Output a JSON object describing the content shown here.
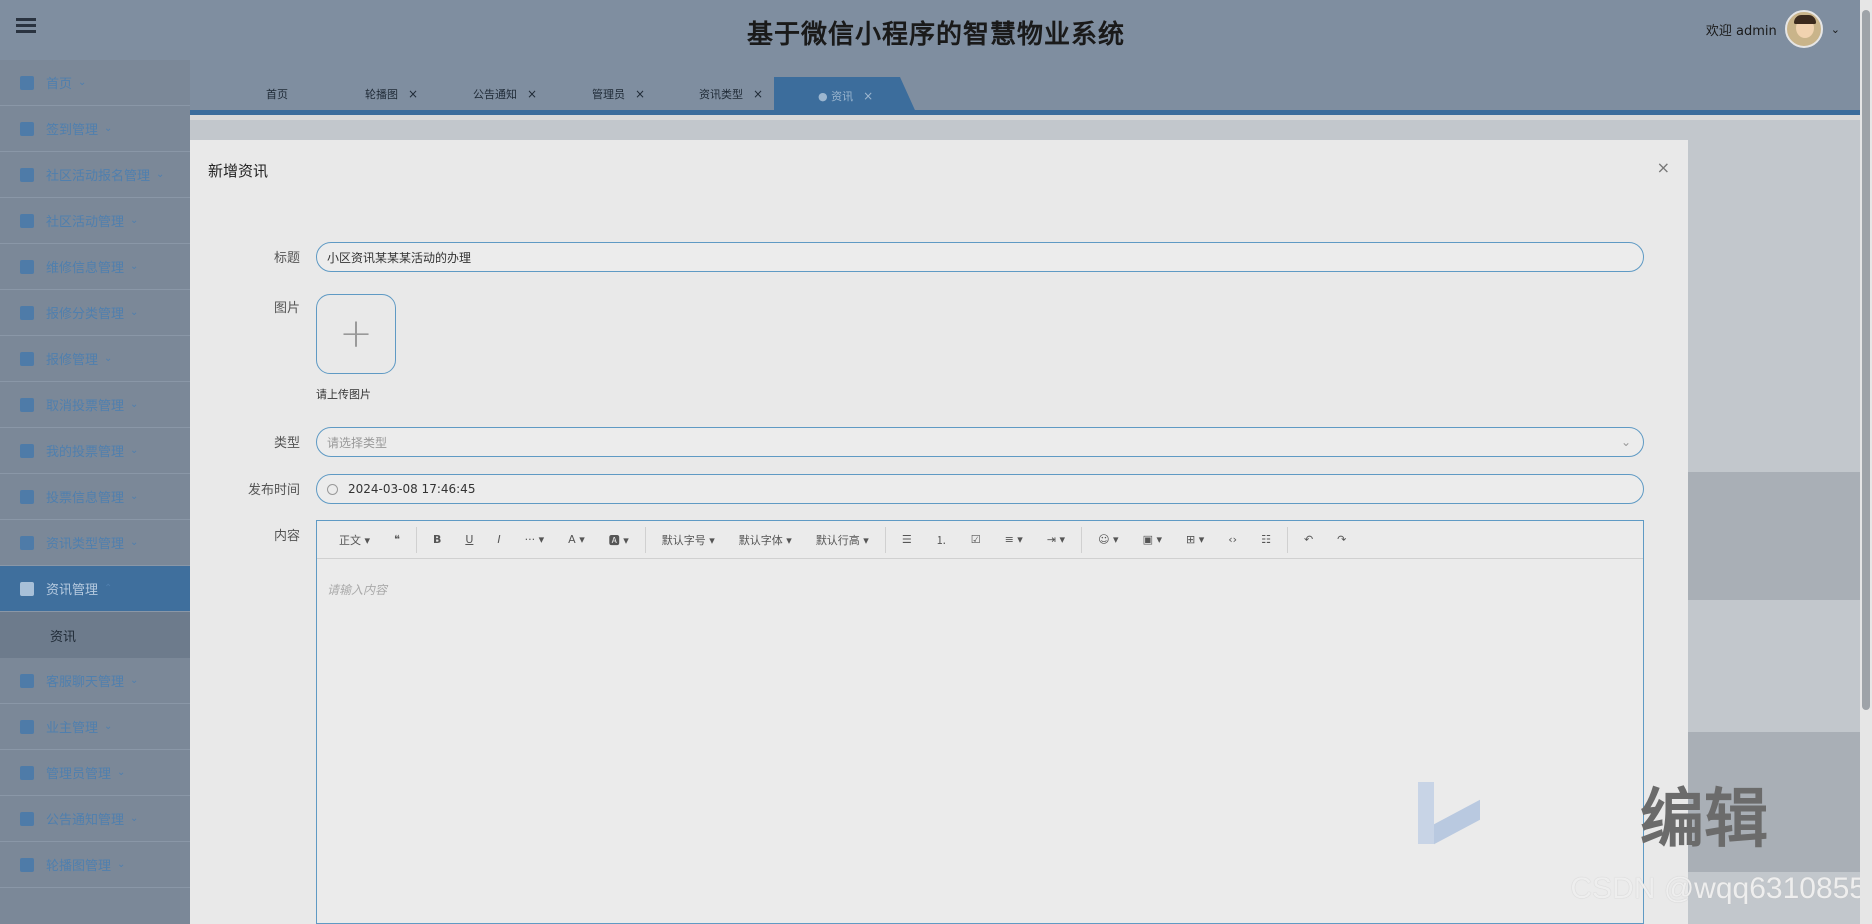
{
  "header": {
    "title": "基于微信小程序的智慧物业系统",
    "welcome": "欢迎 admin",
    "menu_icon": "hamburger-icon",
    "avatar_icon": "user-avatar"
  },
  "sidebar": {
    "items": [
      {
        "label": "首页"
      },
      {
        "label": "签到管理"
      },
      {
        "label": "社区活动报名管理"
      },
      {
        "label": "社区活动管理"
      },
      {
        "label": "维修信息管理"
      },
      {
        "label": "报修分类管理"
      },
      {
        "label": "报修管理"
      },
      {
        "label": "取消投票管理"
      },
      {
        "label": "我的投票管理"
      },
      {
        "label": "投票信息管理"
      },
      {
        "label": "资讯类型管理"
      },
      {
        "label": "资讯管理"
      },
      {
        "label": "客服聊天管理"
      },
      {
        "label": "业主管理"
      },
      {
        "label": "管理员管理"
      },
      {
        "label": "公告通知管理"
      },
      {
        "label": "轮播图管理"
      }
    ],
    "sub_item": "资讯"
  },
  "tabs": [
    {
      "label": "首页"
    },
    {
      "label": "轮播图"
    },
    {
      "label": "公告通知"
    },
    {
      "label": "管理员"
    },
    {
      "label": "资讯类型"
    },
    {
      "label": "● 资讯"
    }
  ],
  "dialog": {
    "title": "新增资讯",
    "close": "×",
    "fields": {
      "title_label": "标题",
      "title_value": "小区资讯某某某活动的办理",
      "image_label": "图片",
      "upload_plus": "+",
      "upload_tip": "请上传图片",
      "type_label": "类型",
      "type_placeholder": "请选择类型",
      "time_label": "发布时间",
      "time_value": "2024-03-08 17:46:45",
      "content_label": "内容",
      "content_placeholder": "请输入内容"
    },
    "toolbar": [
      "正文 ▾",
      "❝",
      "B",
      "U",
      "I",
      "··· ▾",
      "A ▾",
      "🅰 ▾",
      "默认字号 ▾",
      "默认字体 ▾",
      "默认行高 ▾",
      "☰",
      "⒈",
      "☑",
      "≡ ▾",
      "⇥ ▾",
      "☺ ▾",
      "▣ ▾",
      "⊞ ▾",
      "‹›",
      "☷",
      "↶",
      "↷"
    ]
  },
  "watermark": {
    "text": "编辑",
    "csdn": "CSDN @wqq6310855"
  }
}
